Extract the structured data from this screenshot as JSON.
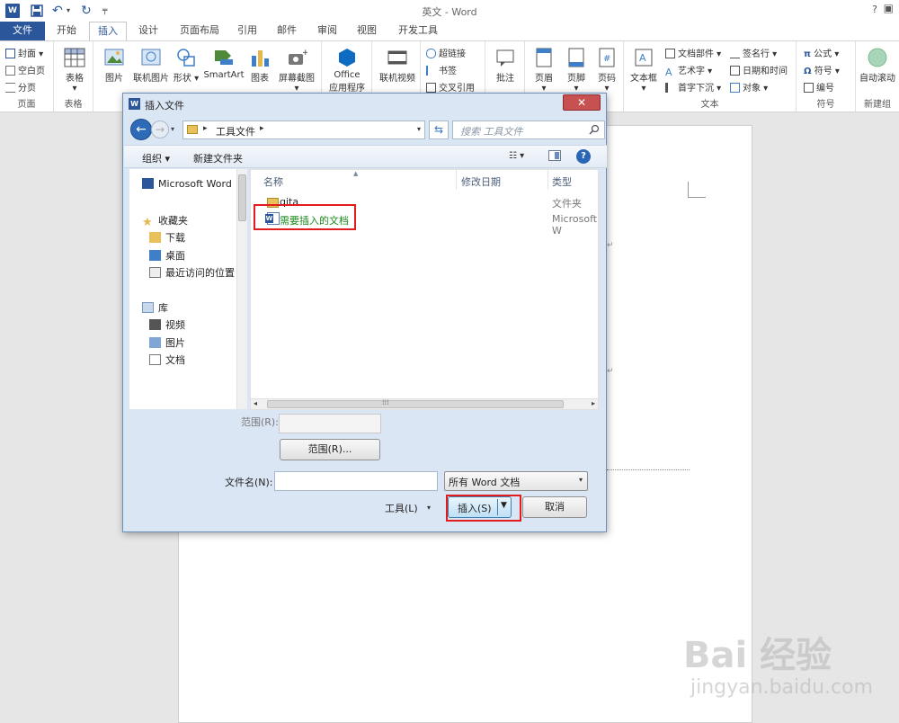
{
  "window": {
    "title": "英文 - Word",
    "help": "?",
    "word_logo": "W"
  },
  "tabs": [
    "文件",
    "开始",
    "插入",
    "设计",
    "页面布局",
    "引用",
    "邮件",
    "审阅",
    "视图",
    "开发工具"
  ],
  "ribbon": {
    "pages": {
      "label": "页面",
      "items": [
        "封面",
        "空白页",
        "分页"
      ]
    },
    "tables": {
      "label": "表格",
      "items": [
        "表格"
      ]
    },
    "illustrations": {
      "items": [
        "图片",
        "联机图片",
        "形状",
        "SmartArt",
        "图表",
        "屏幕截图"
      ]
    },
    "office": {
      "line1": "Office",
      "line2": "应用程序"
    },
    "media": {
      "items": [
        "联机视频"
      ]
    },
    "links": {
      "items": [
        "超链接",
        "书签",
        "交叉引用"
      ]
    },
    "comments": {
      "items": [
        "批注"
      ]
    },
    "header_footer": {
      "items": [
        "页眉",
        "页脚",
        "页码"
      ]
    },
    "text": {
      "label": "文本",
      "textbox": "文本框",
      "items": [
        "文档部件",
        "艺术字",
        "首字下沉",
        "签名行",
        "日期和时间",
        "对象"
      ]
    },
    "symbols": {
      "label": "符号",
      "items": [
        "公式",
        "符号",
        "编号"
      ]
    },
    "new_group": {
      "label": "新建组",
      "items": [
        "自动滚动"
      ]
    }
  },
  "dialog": {
    "title": "插入文件",
    "path": "工具文件",
    "search_placeholder": "搜索 工具文件",
    "toolbar": {
      "organize": "组织 ▾",
      "new_folder": "新建文件夹",
      "view": "☷ ▾",
      "help": "?"
    },
    "nav": {
      "word": "Microsoft Word",
      "favorites": "收藏夹",
      "downloads": "下载",
      "desktop": "桌面",
      "recent": "最近访问的位置",
      "libraries": "库",
      "videos": "视频",
      "pictures": "图片",
      "documents": "文档"
    },
    "columns": {
      "name": "名称",
      "date": "修改日期",
      "type": "类型"
    },
    "files": [
      {
        "name": "qita",
        "type": "文件夹"
      },
      {
        "name": "需要插入的文档",
        "type": "Microsoft W"
      }
    ],
    "range_label": "范围(R):",
    "range_button": "范围(R)...",
    "filename_label": "文件名(N):",
    "filename_value": "",
    "filetype": "所有 Word 文档",
    "tools": "工具(L)",
    "insert": "插入(S)",
    "cancel": "取消"
  },
  "watermark": {
    "logo": "Bai 经验",
    "url": "jingyan.baidu.com"
  },
  "colors": {
    "accent": "#2b579a",
    "highlight": "#e01c1c",
    "file_link": "#1a8a1a"
  }
}
